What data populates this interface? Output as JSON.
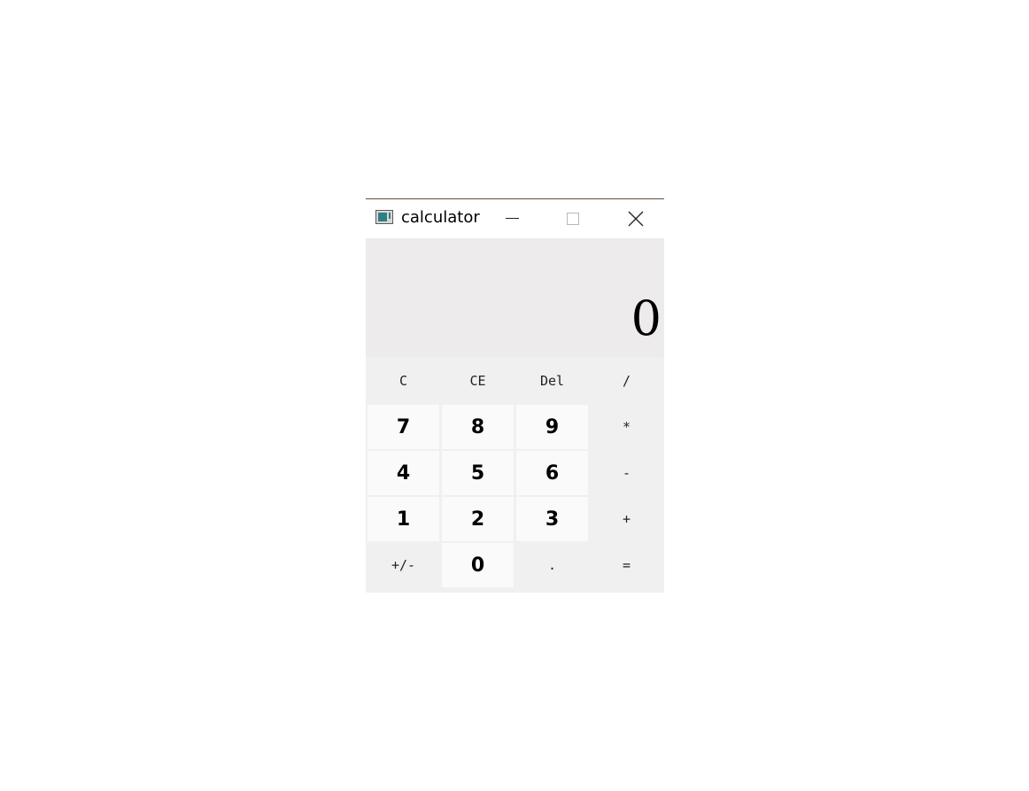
{
  "window": {
    "title": "calculator"
  },
  "display": {
    "value": "0"
  },
  "keys": {
    "row1": [
      "C",
      "CE",
      "Del",
      "/"
    ],
    "row2": [
      "7",
      "8",
      "9",
      "*"
    ],
    "row3": [
      "4",
      "5",
      "6",
      "-"
    ],
    "row4": [
      "1",
      "2",
      "3",
      "+"
    ],
    "row5": [
      "+/-",
      "0",
      ".",
      "="
    ]
  },
  "colors": {
    "display_bg": "#edebeb",
    "keypad_bg": "#f0f0f0",
    "number_key_bg": "#fafafa",
    "app_icon_accent": "#2f7f86"
  }
}
